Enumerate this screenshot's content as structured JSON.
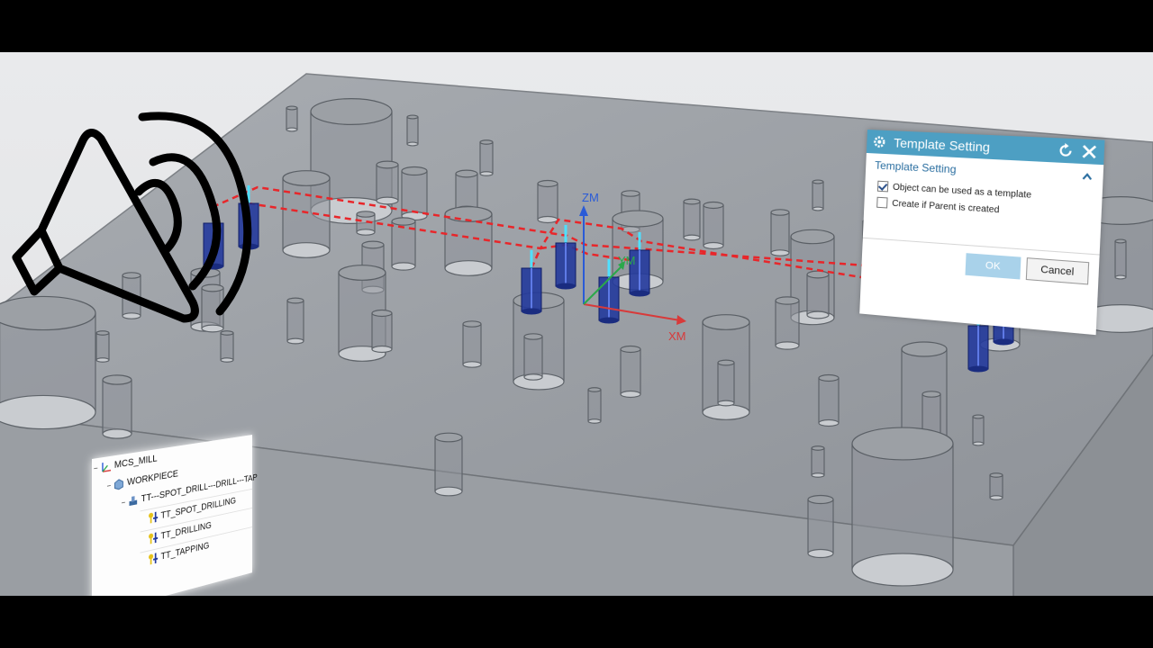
{
  "viewport": {
    "axes": {
      "z_label": "ZM",
      "x_label": "XM",
      "y_label": "YM"
    },
    "colors": {
      "toolpath": "#e8262a",
      "tool": "#243a9c",
      "z_axis": "#2a5bd7",
      "x_axis": "#d83a3a",
      "y_axis": "#2aa84a"
    }
  },
  "speaker_icon": "speaker-volume-icon",
  "template_dialog": {
    "title": "Template Setting",
    "section_label": "Template Setting",
    "option_1": {
      "label": "Object can be used as a template",
      "checked": true
    },
    "option_2": {
      "label": "Create if Parent is created",
      "checked": false
    },
    "ok_label": "OK",
    "cancel_label": "Cancel",
    "title_color": "#4d9fc3"
  },
  "navigator": {
    "nodes": [
      {
        "label": "MCS_MILL",
        "icon": "mcs-icon"
      },
      {
        "label": "WORKPIECE",
        "icon": "workpiece-icon"
      },
      {
        "label": "TT---SPOT_DRILL---DRILL---TAP",
        "icon": "tool-group-icon"
      },
      {
        "label": "TT_SPOT_DRILLING",
        "icon": "drill-operation-icon"
      },
      {
        "label": "TT_DRILLING",
        "icon": "drill-operation-icon"
      },
      {
        "label": "TT_TAPPING",
        "icon": "drill-operation-icon"
      }
    ]
  }
}
